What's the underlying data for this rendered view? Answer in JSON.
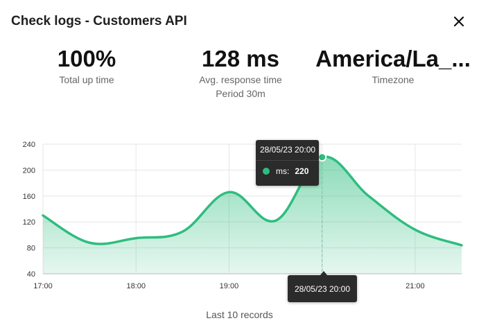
{
  "dialog": {
    "title": "Check logs - Customers API",
    "close_icon": "close-icon"
  },
  "stats": {
    "uptime": {
      "value": "100%",
      "label": "Total up time"
    },
    "response": {
      "value": "128 ms",
      "label": "Avg. response time",
      "sub": "Period 30m"
    },
    "timezone": {
      "value": "America/La_...",
      "label": "Timezone"
    }
  },
  "chart_data": {
    "type": "area",
    "x_ticks": [
      "17:00",
      "18:00",
      "19:00",
      "20:00",
      "21:00"
    ],
    "y_ticks": [
      40,
      80,
      120,
      160,
      200,
      240
    ],
    "ylim": [
      40,
      240
    ],
    "xlim_hours": [
      17.0,
      21.5
    ],
    "series": [
      {
        "name": "ms",
        "points": [
          [
            17.0,
            130
          ],
          [
            17.5,
            88
          ],
          [
            18.0,
            95
          ],
          [
            18.5,
            105
          ],
          [
            19.0,
            166
          ],
          [
            19.5,
            122
          ],
          [
            20.0,
            220
          ],
          [
            20.5,
            160
          ],
          [
            21.0,
            108
          ],
          [
            21.5,
            84
          ]
        ]
      }
    ],
    "color": "#2ebd7f",
    "grid": true,
    "highlight": {
      "index": 6,
      "datetime": "28/05/23 20:00",
      "label": "ms:",
      "value": "220"
    }
  },
  "footer": {
    "text": "Last 10 records"
  }
}
